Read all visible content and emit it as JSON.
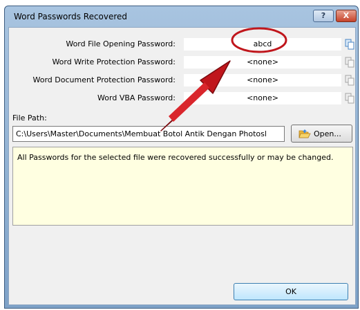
{
  "window": {
    "title": "Word Passwords Recovered",
    "help_label": "?",
    "close_label": "X"
  },
  "passwords": [
    {
      "label": "Word File Opening Password:",
      "value": "abcd"
    },
    {
      "label": "Word Write Protection Password:",
      "value": "<none>"
    },
    {
      "label": "Word Document Protection Password:",
      "value": "<none>"
    },
    {
      "label": "Word VBA Password:",
      "value": "<none>"
    }
  ],
  "file_path": {
    "label": "File Path:",
    "value": "C:\\Users\\Master\\Documents\\Membuat Botol Antik Dengan Photosl",
    "open_button": "Open..."
  },
  "message": "All Passwords for the selected file were recovered successfully or may be changed.",
  "ok_button": "OK",
  "colors": {
    "annotation_red": "#c0161c",
    "message_background": "#ffffe1",
    "title_bar": "#a8c4e0"
  }
}
